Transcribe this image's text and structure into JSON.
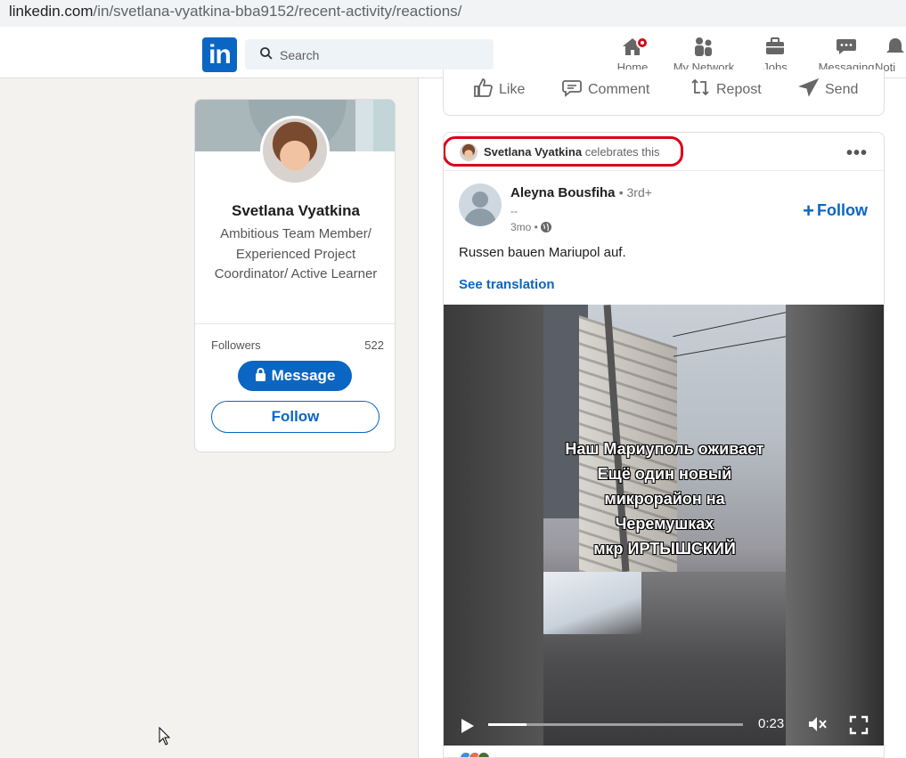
{
  "browser": {
    "url_host": "linkedin.com",
    "url_path": "/in/svetlana-vyatkina-bba9152/recent-activity/reactions/"
  },
  "nav": {
    "logo": "in",
    "search_placeholder": "Search",
    "items": [
      {
        "label": "Home",
        "icon": "home-icon"
      },
      {
        "label": "My Network",
        "icon": "network-icon"
      },
      {
        "label": "Jobs",
        "icon": "briefcase-icon"
      },
      {
        "label": "Messaging",
        "icon": "chat-icon"
      },
      {
        "label": "Noti",
        "icon": "bell-icon"
      }
    ]
  },
  "profile": {
    "name": "Svetlana Vyatkina",
    "headline": "Ambitious Team Member/ Experienced Project Coordinator/ Active Learner",
    "followers_label": "Followers",
    "followers_count": "522",
    "message_label": "Message",
    "follow_label": "Follow"
  },
  "actions": {
    "like": "Like",
    "comment": "Comment",
    "repost": "Repost",
    "send": "Send"
  },
  "post": {
    "reactor_name": "Svetlana Vyatkina",
    "reactor_action": "celebrates this",
    "more": "•••",
    "author_name": "Aleyna Bousfiha",
    "author_degree": "• 3rd+",
    "author_subtitle": "--",
    "time": "3mo •",
    "follow_label": "Follow",
    "follow_plus": "+",
    "text": "Russen bauen Mariupol auf.",
    "translate_label": "See translation",
    "video": {
      "caption": [
        "Наш Мариуполь оживает",
        "Ещё один новый",
        "микрорайон на",
        "Черемушках",
        "мкр ИРТЫШСКИЙ"
      ],
      "time": "0:23",
      "progress": 0.15
    }
  },
  "colors": {
    "brand": "#0a66c2",
    "highlight": "#d9001b",
    "badge": "#cc1016"
  }
}
